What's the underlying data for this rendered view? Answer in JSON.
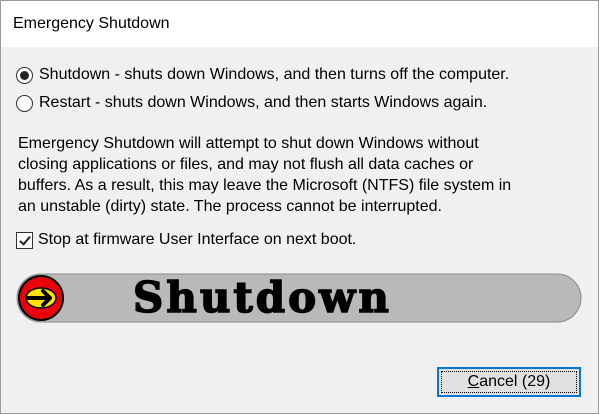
{
  "window": {
    "title": "Emergency Shutdown"
  },
  "options": {
    "shutdown_label": "Shutdown - shuts down Windows, and then turns off the computer.",
    "restart_label": "Restart - shuts down Windows, and then starts Windows again.",
    "selected": "shutdown"
  },
  "description": {
    "lines": [
      "Emergency Shutdown will attempt to shut down Windows without",
      "closing applications or files, and may not flush all data caches or",
      "buffers.  As a result, this may leave the Microsoft (NTFS) file system in",
      "an unstable (dirty) state.  The process cannot be interrupted."
    ]
  },
  "firmware_option": {
    "label": "Stop at firmware User Interface on next boot.",
    "checked": true
  },
  "banner": {
    "text": "Shutdown",
    "icon": "arrow-right-icon"
  },
  "cancel_button": {
    "accelerator": "C",
    "label_rest": "ancel (29)"
  },
  "colors": {
    "focus_border": "#0078d7",
    "banner_fill": "#b9b9b9",
    "arrow_circle": "#e8000b",
    "arrow_fill": "#ffe400"
  }
}
